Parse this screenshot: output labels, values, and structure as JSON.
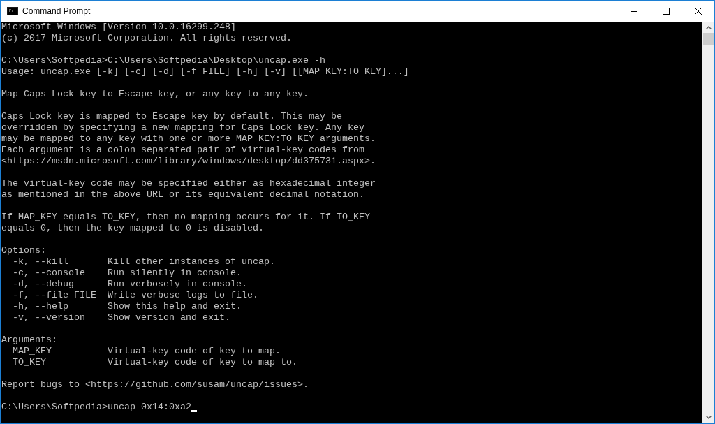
{
  "window": {
    "title": "Command Prompt"
  },
  "console": {
    "blocks": [
      [
        "Microsoft Windows [Version 10.0.16299.248]",
        "(c) 2017 Microsoft Corporation. All rights reserved."
      ],
      [
        "C:\\Users\\Softpedia>C:\\Users\\Softpedia\\Desktop\\uncap.exe -h",
        "Usage: uncap.exe [-k] [-c] [-d] [-f FILE] [-h] [-v] [[MAP_KEY:TO_KEY]...]"
      ],
      [
        "Map Caps Lock key to Escape key, or any key to any key."
      ],
      [
        "Caps Lock key is mapped to Escape key by default. This may be",
        "overridden by specifying a new mapping for Caps Lock key. Any key",
        "may be mapped to any key with one or more MAP_KEY:TO_KEY arguments.",
        "Each argument is a colon separated pair of virtual-key codes from",
        "<https://msdn.microsoft.com/library/windows/desktop/dd375731.aspx>."
      ],
      [
        "The virtual-key code may be specified either as hexadecimal integer",
        "as mentioned in the above URL or its equivalent decimal notation."
      ],
      [
        "If MAP_KEY equals TO_KEY, then no mapping occurs for it. If TO_KEY",
        "equals 0, then the key mapped to 0 is disabled."
      ],
      [
        "Options:",
        "  -k, --kill       Kill other instances of uncap.",
        "  -c, --console    Run silently in console.",
        "  -d, --debug      Run verbosely in console.",
        "  -f, --file FILE  Write verbose logs to file.",
        "  -h, --help       Show this help and exit.",
        "  -v, --version    Show version and exit."
      ],
      [
        "Arguments:",
        "  MAP_KEY          Virtual-key code of key to map.",
        "  TO_KEY           Virtual-key code of key to map to."
      ],
      [
        "Report bugs to <https://github.com/susam/uncap/issues>."
      ]
    ],
    "prompt": "C:\\Users\\Softpedia>uncap 0x14:0xa2"
  }
}
